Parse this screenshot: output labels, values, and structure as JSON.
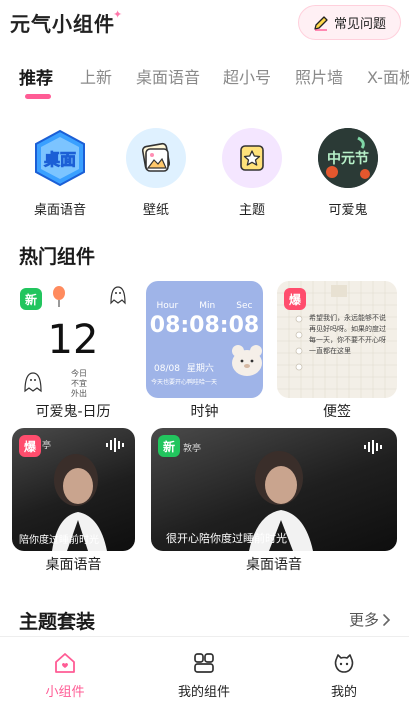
{
  "header": {
    "app_title": "元气小组件",
    "sparkle": "✦",
    "faq_label": "常见问题",
    "faq_icon": "pencil-icon"
  },
  "tabs": [
    {
      "label": "推荐",
      "active": true
    },
    {
      "label": "上新",
      "active": false
    },
    {
      "label": "桌面语音",
      "active": false
    },
    {
      "label": "超小号",
      "active": false
    },
    {
      "label": "照片墙",
      "active": false
    },
    {
      "label": "X-面板",
      "active": false
    }
  ],
  "quick_access": [
    {
      "label": "桌面语音",
      "icon": "desktop-voice-logo",
      "logo_text": "桌面"
    },
    {
      "label": "壁纸",
      "icon": "picture-icon"
    },
    {
      "label": "主题",
      "icon": "theme-star-icon"
    },
    {
      "label": "可爱鬼",
      "icon": "cute-ghost-avatar",
      "logo_text": "中元节"
    }
  ],
  "hot_section": {
    "title": "热门组件",
    "widgets": [
      {
        "label": "可爱鬼-日历",
        "badge": "新",
        "badge_type": "new",
        "date": "12",
        "notes": [
          "今日",
          "不宜",
          "外出"
        ]
      },
      {
        "label": "时钟",
        "badge": "",
        "hour_label": "Hour",
        "min_label": "Min",
        "sec_label": "Sec",
        "time": "08:08:08",
        "date_line": "08/08",
        "weekday": "星期六",
        "caption": "今天也要开心鸭哇哈一天"
      },
      {
        "label": "便签",
        "badge": "爆",
        "badge_type": "hot",
        "note": "希望我们，永远能够不说再见好吗呀。如果的度过每一天，你不要不开心呀一直都在这里"
      },
      {
        "label": "桌面语音",
        "badge": "爆",
        "badge_type": "hot",
        "name_tag": "亭",
        "caption": "陪你度过睡前时光"
      },
      {
        "label": "桌面语音",
        "badge": "新",
        "badge_type": "new",
        "name_tag": "敦亭",
        "caption": "很开心陪你度过睡前时光"
      }
    ]
  },
  "theme_section": {
    "title": "主题套装",
    "more_label": "更多",
    "more_icon": "chevron-right-icon"
  },
  "bottom_nav": [
    {
      "label": "小组件",
      "icon": "home-heart-icon",
      "active": true
    },
    {
      "label": "我的组件",
      "icon": "widgets-grid-icon",
      "active": false
    },
    {
      "label": "我的",
      "icon": "profile-face-icon",
      "active": false
    }
  ],
  "colors": {
    "accent": "#ff5c95",
    "badge_new": "#22c55e",
    "badge_hot": "#ff4d6d",
    "clock_bg": "#9fb4e8"
  }
}
